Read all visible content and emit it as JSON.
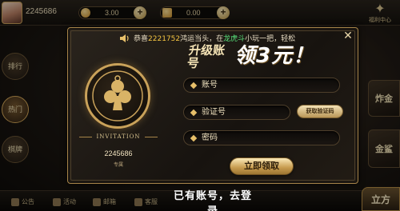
{
  "top": {
    "user_id": "2245686",
    "coins": "3.00",
    "bank": "0.00",
    "corner_label": "福利中心"
  },
  "sidebar": {
    "items": [
      {
        "label": "排行"
      },
      {
        "label": "热门"
      },
      {
        "label": "棋牌"
      }
    ]
  },
  "right_tiles": [
    {
      "label": "炸金"
    },
    {
      "label": "金鲨"
    }
  ],
  "bottom": {
    "items": [
      "公告",
      "活动",
      "邮箱",
      "客服"
    ],
    "right_label": "立方"
  },
  "modal": {
    "marquee_parts": [
      "恭喜",
      "2221752",
      "鸿运当头，在",
      "龙虎斗",
      "小玩一把，轻松"
    ],
    "headline_small": "升级账号",
    "headline_big": "领3元！",
    "invitation_label": "INVITATION",
    "invite_code": "2245686",
    "invite_sub": "专属",
    "fields": {
      "account_placeholder": "账号",
      "code_placeholder": "验证号",
      "password_placeholder": "密码"
    },
    "get_code_label": "获取验证码",
    "submit_label": "立即领取",
    "close_symbol": "✕"
  },
  "footer_link": "已有账号，去登录",
  "colors": {
    "gold": "#c9a25a",
    "marquee_highlight": "#f4c542",
    "marquee_game": "#58e07a"
  }
}
